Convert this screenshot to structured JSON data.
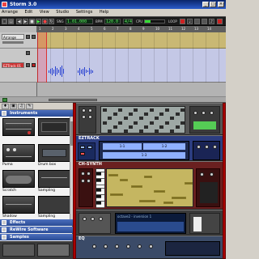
{
  "window": {
    "title": "Storm 3.0",
    "controls": [
      "_",
      "□",
      "×"
    ]
  },
  "menu": [
    "Arrange",
    "Edit",
    "View",
    "Studio",
    "Settings",
    "Help"
  ],
  "transport": {
    "position": "1.01.000",
    "tempo": "120.0",
    "signature": "4/4",
    "cpu_label": "CPU",
    "labels": [
      "SNG",
      "BPM",
      "LOOP"
    ]
  },
  "arrangement": {
    "ruler": [
      "1",
      "2",
      "3",
      "4",
      "5",
      "6",
      "7",
      "8",
      "9",
      "10",
      "11",
      "12",
      "13",
      "14"
    ],
    "tracks": [
      {
        "name": "Arrange",
        "selected": false
      },
      {
        "name": "EZTrack 01",
        "selected": true
      }
    ]
  },
  "browser": {
    "categories": {
      "instruments": "Instruments",
      "effects": "Effects",
      "rewire": "ReWire Software",
      "samples": "Samples"
    },
    "instruments": [
      {
        "left": "Puma",
        "right": "Drum box"
      },
      {
        "left": "Scratch",
        "right": "Sampling"
      },
      {
        "left": "Shadow",
        "right": "Sampling"
      }
    ]
  },
  "rack": {
    "devices": {
      "ezback": "EZTRACK",
      "synth": "CH-SYNTH",
      "arp": "EQ"
    },
    "sequencer_rows": [
      "1-1",
      "1-2",
      "1-3"
    ],
    "synth_note": "octave2 - inversion 1"
  }
}
